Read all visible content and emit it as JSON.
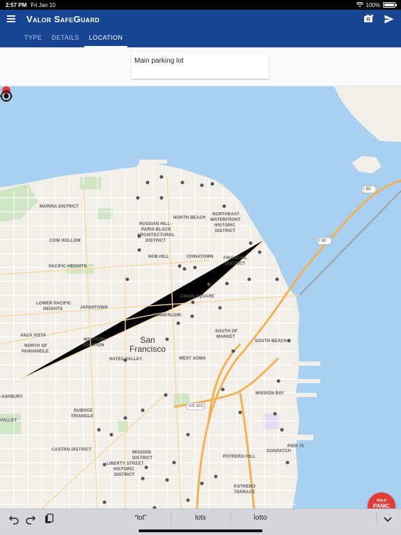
{
  "status": {
    "time": "2:57 PM",
    "date": "Fri Jan 10",
    "battery": "100%"
  },
  "app": {
    "title": "Valor SafeGuard"
  },
  "tabs": [
    {
      "label": "TYPE"
    },
    {
      "label": "DETAILS"
    },
    {
      "label": "LOCATION"
    }
  ],
  "active_tab": "LOCATION",
  "location_input": {
    "value": "Main parking lot"
  },
  "map": {
    "city": [
      "San",
      "Francisco"
    ],
    "districts": [
      "MARINA DISTRICT",
      "COW HOLLOW",
      "PACIFIC HEIGHTS",
      "RUSSIAN HILL-",
      "PARIS BLOCK",
      "ARCHITECTURAL",
      "DISTRICT",
      "NORTH BEACH",
      "NORTHEAST",
      "WATERFRONT",
      "HISTORIC",
      "DISTRICT",
      "NOB HILL",
      "CHINATOWN",
      "FINANCIAL",
      "DISTRICT",
      "LOWER PACIFIC",
      "HEIGHTS",
      "JAPANTOWN",
      "UNION SQUARE",
      "TENDERLOIN",
      "ANZA VISTA",
      "NORTH OF",
      "PANHANDLE",
      "WESTERN",
      "ADDITION",
      "HAYES VALLEY",
      "SOUTH OF",
      "MARKET",
      "SOUTH BEACH",
      "WEST SOMA",
      "MISSION BAY",
      "DUBOCE",
      "TRIANGLE",
      "CASTRO DISTRICT",
      "MISSION",
      "DISTRICT",
      "LIBERTY STREET",
      "HISTORIC",
      "DISTRICT",
      "POTRERO HILL",
      "DOGPATCH",
      "PIER 70",
      "POTRERO",
      "TERRACE",
      "-ASHBURY",
      "VALLEY"
    ],
    "shields": [
      "I 80",
      "I 80",
      "US 101"
    ]
  },
  "panic": {
    "line1": "HOLD",
    "line2": "PANIC"
  },
  "keyboard": {
    "suggestions": [
      "“lot”",
      "lots",
      "lotto"
    ]
  },
  "colors": {
    "appbar": "#174593",
    "water": "#a8d0f0",
    "land": "#f2efe9",
    "panic": "#e53935"
  }
}
